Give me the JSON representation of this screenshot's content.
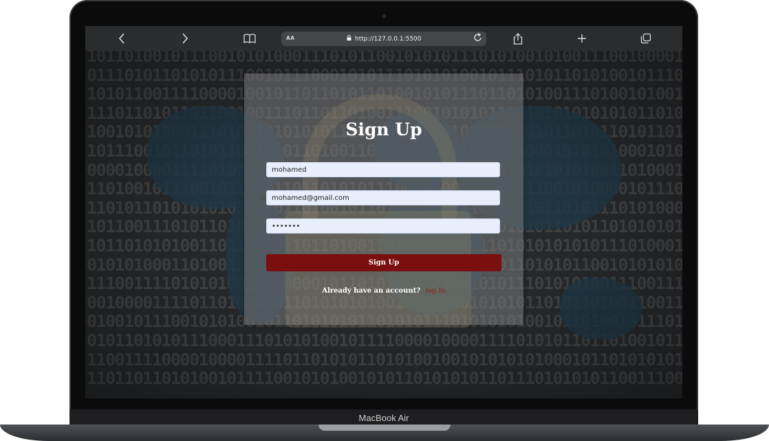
{
  "device": {
    "label": "MacBook Air"
  },
  "browser": {
    "text_size_label": "AA",
    "url": "http://127.0.0.1:5500",
    "icons": {
      "back": "chevron-left-icon",
      "forward": "chevron-right-icon",
      "bookmarks": "book-icon",
      "reload": "reload-icon",
      "share": "share-icon",
      "new_tab": "plus-icon",
      "tabs": "tabs-icon",
      "lock": "lock-icon"
    }
  },
  "signup": {
    "title": "Sign Up",
    "username_value": "mohamed",
    "email_value": "mohamed@gmail.com",
    "password_value": "•••••••",
    "submit_label": "Sign Up",
    "account_prompt": "Already have an account?",
    "login_link": "log In"
  },
  "background": {
    "binary_rows": [
      "1011010010111001010100011101011001010101110101001010011100100001000111010",
      "0111010110101011100101110001010111010101001011101011010100101110010110101",
      "1010110011110000100101101101011010010101110110101001110100101001011010111",
      "1110110101101100100111011011010011100101010111010101010101011010101110000",
      "1001010100011101011010101011100101000101000111101011010110101101000101011",
      "1011100101101011001010110100110101011001101011100010101010001010001111011",
      "0000100001111010111010100101011101010100101101010101010011010001101010110",
      "1101001011100101101011011010101110010100011010111001010000101110111010101",
      "1101011010101010101101101001011010010001111010110110101110101000110010111",
      "1011001110101101011010100010110101011010010101010110101101010101101011100",
      "1011010101001101101101101101001101010110101101010101010111010001100001010",
      "0101010001101001101011010101110101010100010101101010110010101010101000111",
      "1110011110101010011010000101101010101011010101110101010011100111100101011",
      "0010000111101101010101101010101001011001010101011010110100110011110010110",
      "0100101110010101001011010101011010101110101010100101101001011101011100101",
      "0101101010111000111010101001011110000100001111010101101101001011011010110",
      "1100111100001000011110110101011010100100101010101000101101010101011100101",
      "1101101101010010111100101010010101101010101101110101010110011100001000011"
    ],
    "accent_color": "#213846"
  },
  "colors": {
    "button": "#7a0f0f",
    "link": "#9a1c1c",
    "field": "#e8eefc"
  }
}
